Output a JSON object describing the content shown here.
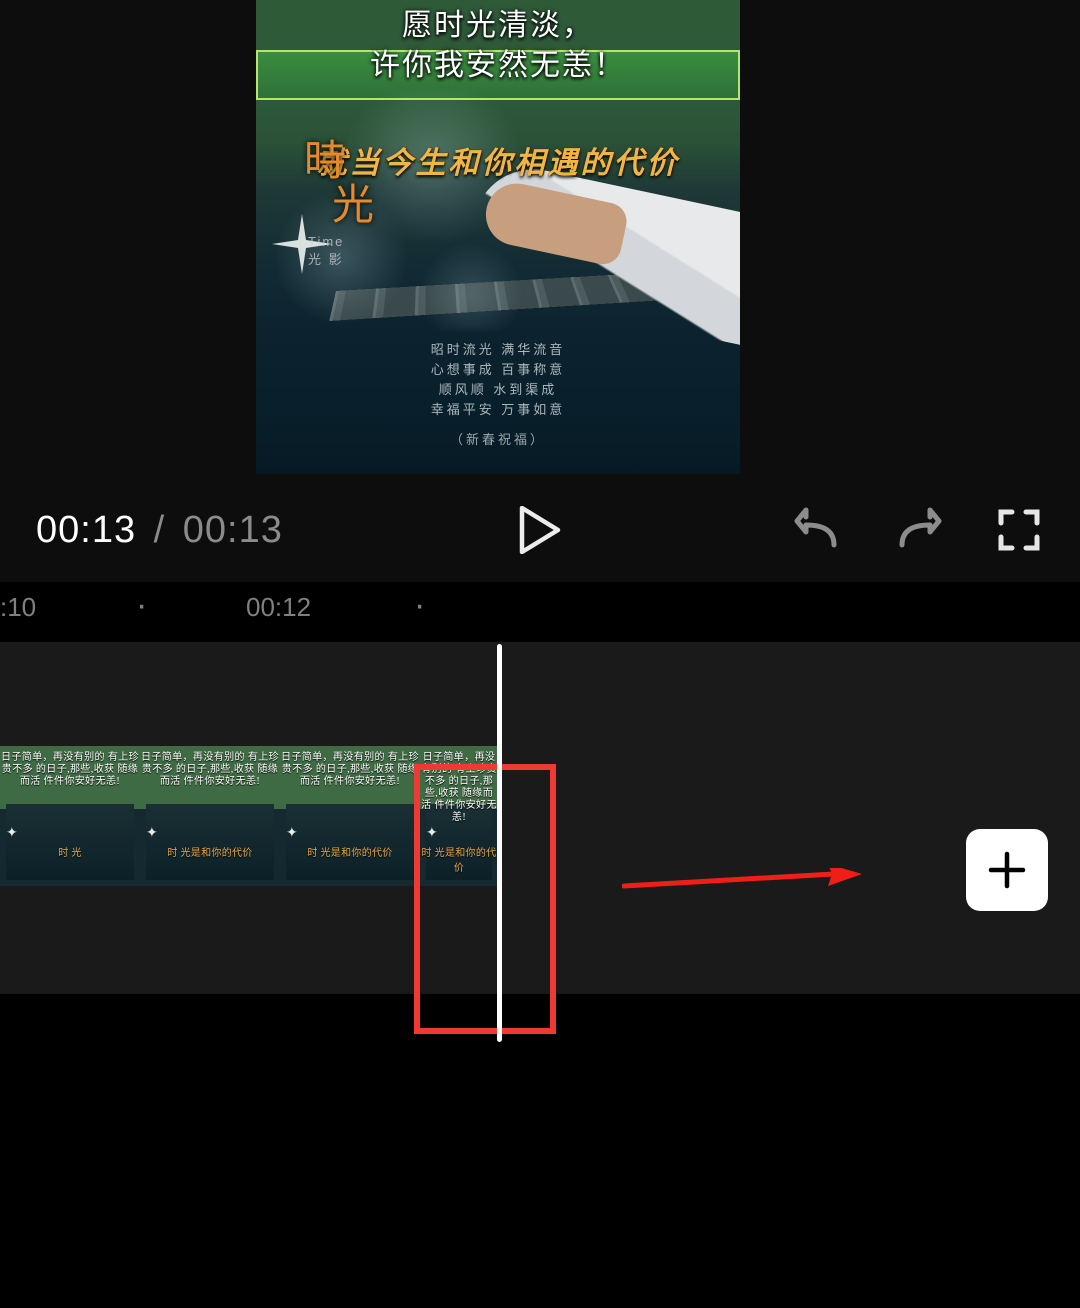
{
  "preview": {
    "overlay_top_line1": "愿时光清淡，",
    "overlay_top_line2": "许你我安然无恙！",
    "lyric_caption": "就当今生和你相遇的代价",
    "side_title_char1": "時",
    "side_title_char2": "光",
    "side_sub1": "Time",
    "side_sub2": "光   影",
    "credits_line1": "昭时流光  满华流音",
    "credits_line2": "心想事成  百事称意",
    "credits_line3": "顺风顺   水到渠成",
    "credits_line4": "幸福平安  万事如意",
    "credits_line5": "（新春祝福）"
  },
  "player": {
    "current_time": "00:13",
    "separator": "/",
    "duration": "00:13"
  },
  "ruler": {
    "label_left": ":10",
    "label_mid": "00:12"
  },
  "thumbs": {
    "text_block": "日子简单，再没有别的\n有上珍贵不多\n的日子,那些,收获\n随缘而活\n件件你安好无恙!",
    "lyric_a": "时 光",
    "lyric_b": "时 光是和你的代价"
  },
  "annotation": {
    "highlight_color": "#ef3a33",
    "arrow_color": "#ef1f17"
  },
  "icons": {
    "play": "play-icon",
    "undo": "undo-icon",
    "redo": "redo-icon",
    "fullscreen": "fullscreen-icon",
    "add": "plus-icon",
    "sparkle": "sparkle-icon"
  }
}
